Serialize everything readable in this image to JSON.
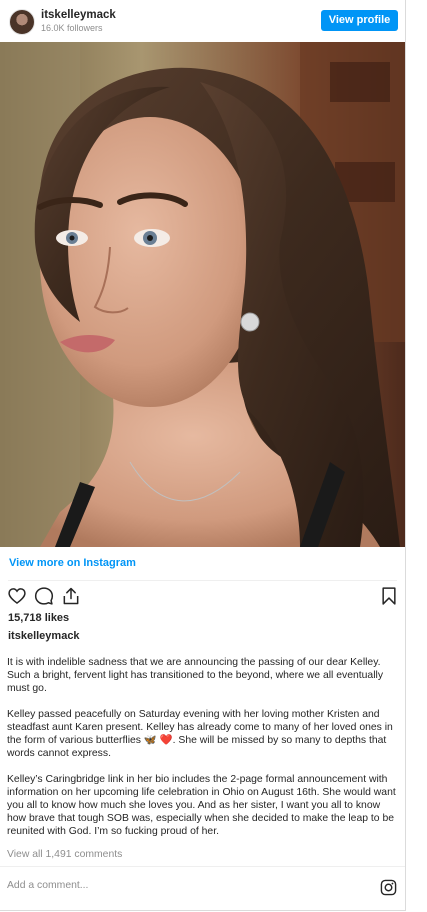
{
  "header": {
    "username": "itskelleymack",
    "followers": "16.0K followers",
    "view_profile_label": "View profile"
  },
  "post": {
    "view_more_label": "View more on Instagram",
    "likes": "15,718 likes",
    "caption_username": "itskelleymack",
    "caption_paragraphs": [
      "It is with indelible sadness that we are announcing the passing of our dear Kelley. Such a bright, fervent light has transitioned to the beyond, where we all eventually must go.",
      "Kelley passed peacefully on Saturday evening with her loving mother Kristen and steadfast aunt Karen present. Kelley has already come to many of her loved ones in the form of various butterflies 🦋 ❤️. She will be missed by so many to depths that words cannot express.",
      "Kelley’s Caringbridge link in her bio includes the 2-page formal announcement with information on her upcoming life celebration in Ohio on August 16th. She would want you all to know how much she loves you. And as her sister, I want you all to know how brave that tough SOB was, especially when she decided to make the leap to be reunited with God. I’m so fucking proud of her."
    ],
    "view_comments_label": "View all 1,491 comments",
    "add_comment_placeholder": "Add a comment..."
  },
  "colors": {
    "accent": "#0095f6",
    "muted": "#8e8e8e",
    "text": "#262626"
  },
  "icons": [
    "heart-icon",
    "comment-icon",
    "share-icon",
    "bookmark-icon",
    "instagram-icon"
  ]
}
